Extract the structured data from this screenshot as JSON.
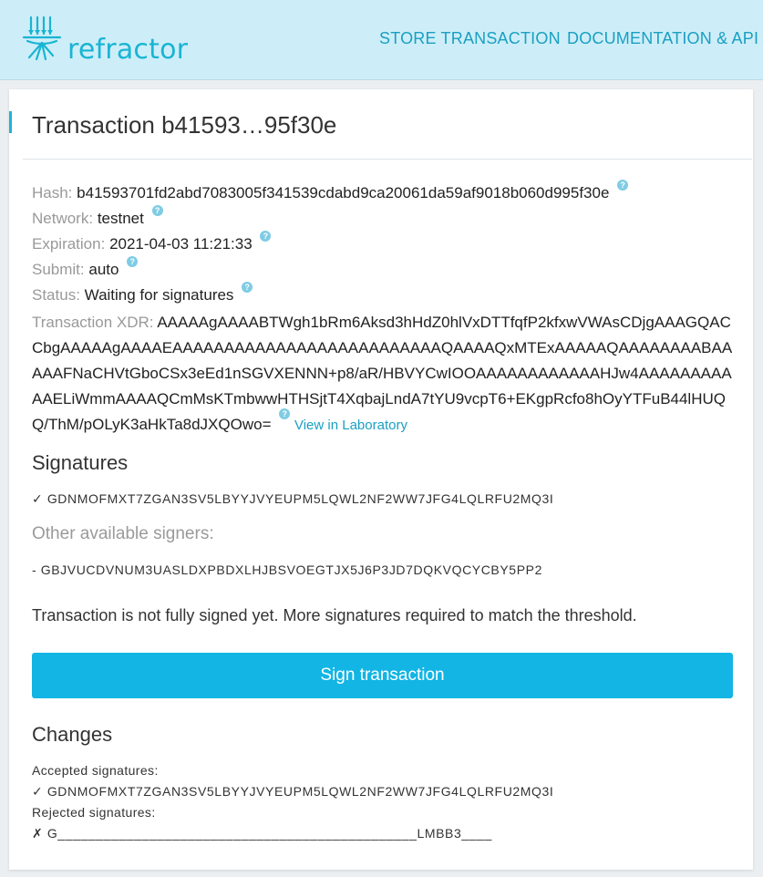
{
  "header": {
    "brand": "refractor",
    "nav": [
      {
        "label": "STORE TRANSACTION"
      },
      {
        "label": "DOCUMENTATION & API"
      }
    ]
  },
  "transaction": {
    "title": "Transaction b41593…95f30e",
    "hash_label": "Hash:",
    "hash": "b41593701fd2abd7083005f341539cdabd9ca20061da59af9018b060d995f30e",
    "network_label": "Network:",
    "network": "testnet",
    "expiration_label": "Expiration:",
    "expiration": "2021-04-03 11:21:33",
    "submit_label": "Submit:",
    "submit": "auto",
    "status_label": "Status:",
    "status": "Waiting for signatures",
    "xdr_label": "Transaction XDR:",
    "xdr": "AAAAAgAAAABTWgh1bRm6Aksd3hHdZ0hlVxDTTfqfP2kfxwVWAsCDjgAAAGQACCbgAAAAAgAAAAEAAAAAAAAAAAAAAAAAAAAAAAAAAQAAAAQxMTExAAAAAQAAAAAAAABAAAAAFNaCHVtGboCSx3eEd1nSGVXENNN+p8/aR/HBVYCwIOOAAAAAAAAAAAAHJw4AAAAAAAAAAAELiWmmAAAAQCmMsKTmbwwHTHSjtT4XqbajLndA7tYU9vcpT6+EKgpRcfo8hOyYTFuB44lHUQQ/ThM/pOLyK3aHkTa8dJXQOwo=",
    "lab_link": "View in Laboratory",
    "help_glyph": "?"
  },
  "signatures": {
    "heading": "Signatures",
    "signed": "✓ GDNMOFMXT7ZGAN3SV5LBYYJVYEUPM5LQWL2NF2WW7JFG4LQLRFU2MQ3I",
    "other_heading": "Other available signers:",
    "other": "- GBJVUCDVNUM3UASLDXPBDXLHJBSVOEGTJX5J6P3JD7DQKVQCYCBY5PP2"
  },
  "notice": "Transaction is not fully signed yet. More signatures required to match the threshold.",
  "sign_button": "Sign transaction",
  "changes": {
    "heading": "Changes",
    "accepted_label": "Accepted signatures:",
    "accepted": "✓ GDNMOFMXT7ZGAN3SV5LBYYJVYEUPM5LQWL2NF2WW7JFG4LQLRFU2MQ3I",
    "rejected_label": "Rejected signatures:",
    "rejected": "✗ G_______________________________________________LMBB3____"
  },
  "colors": {
    "header_bg": "#cdeef8",
    "accent": "#1a9fc2",
    "button": "#12b5e4"
  }
}
